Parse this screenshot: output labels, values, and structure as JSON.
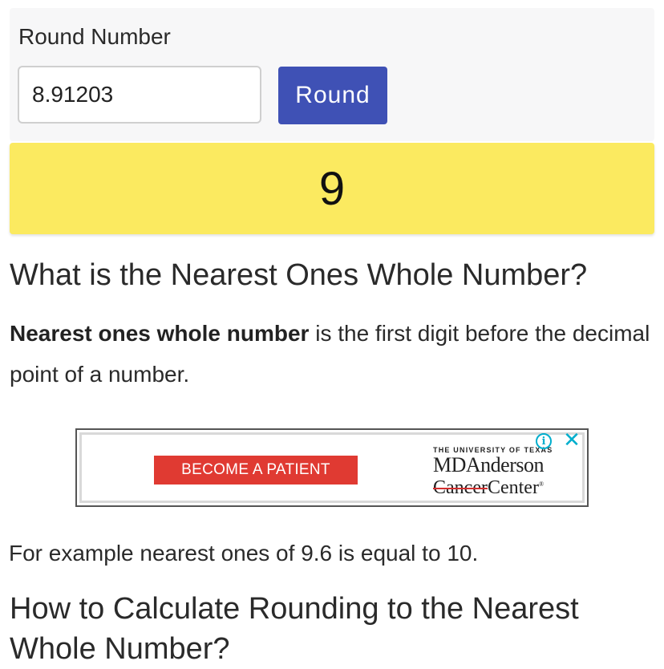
{
  "form": {
    "label": "Round Number",
    "input_value": "8.91203",
    "button_label": "Round"
  },
  "result": {
    "value": "9"
  },
  "heading_1": "What is the Nearest Ones Whole Number?",
  "definition": {
    "bold": "Nearest ones whole number",
    "rest": " is the first digit before the decimal point of a number."
  },
  "ad": {
    "cta": "BECOME A PATIENT",
    "brand_small": "THE UNIVERSITY OF TEXAS",
    "brand_name": "MDAnderson",
    "brand_cancer": "Cancer",
    "brand_center": "Center",
    "trademark": "®",
    "info_icon": "info-icon",
    "close_icon": "close-icon"
  },
  "example": "For example nearest ones of 9.6 is equal to 10.",
  "heading_2": "How to Calculate Rounding to the Nearest Whole Number?",
  "colors": {
    "button": "#3f51b5",
    "result_bg": "#fbea60",
    "ad_cta": "#e03a32",
    "ad_icons": "#00aecd"
  }
}
